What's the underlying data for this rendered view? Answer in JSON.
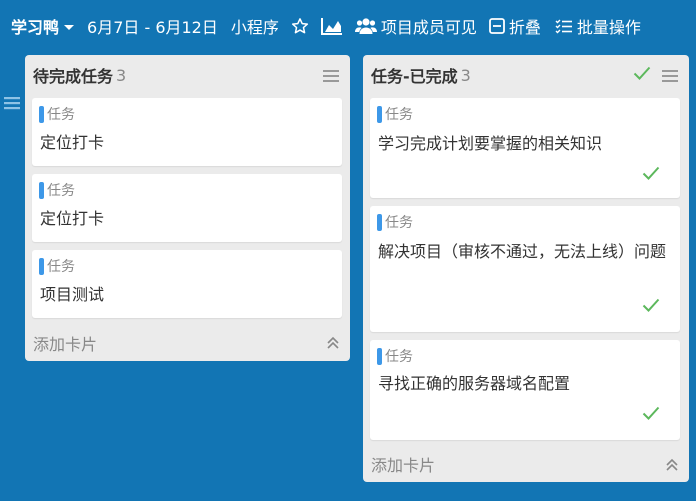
{
  "topbar": {
    "project_name": "学习鸭",
    "date_range": "6月7日 - 6月12日",
    "mini_program": "小程序",
    "members_visible": "项目成员可见",
    "fold": "折叠",
    "batch": "批量操作",
    "icons": [
      "chevron-down-icon",
      "star-icon",
      "chart-icon",
      "users-icon",
      "fold-icon",
      "list-check-icon"
    ]
  },
  "columns": [
    {
      "title": "待完成任务",
      "count": "3",
      "cards": [
        {
          "tag": "任务",
          "title": "定位打卡"
        },
        {
          "tag": "任务",
          "title": "定位打卡"
        },
        {
          "tag": "任务",
          "title": "项目测试"
        }
      ],
      "add_card": "添加卡片"
    },
    {
      "title": "任务-已完成",
      "count": "3",
      "cards": [
        {
          "tag": "任务",
          "title": "学习完成计划要掌握的相关知识",
          "done": true
        },
        {
          "tag": "任务",
          "title": "解决项目（审核不通过，无法上线）问题",
          "done": true
        },
        {
          "tag": "任务",
          "title": "寻找正确的服务器域名配置",
          "done": true
        }
      ],
      "add_card": "添加卡片"
    }
  ],
  "colors": {
    "background": "#1275b4",
    "tag": "#3d98e8",
    "check": "#5cb85c"
  }
}
